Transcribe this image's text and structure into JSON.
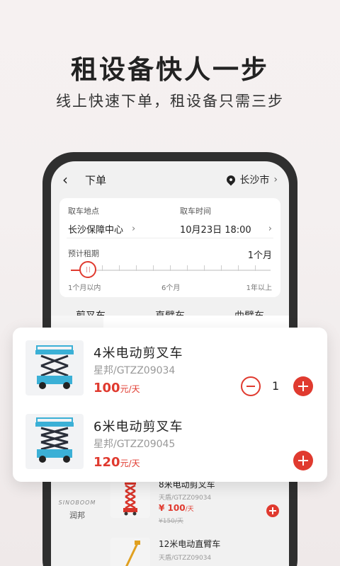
{
  "headline": "租设备快人一步",
  "subline": "线上快速下单，租设备只需三步",
  "nav": {
    "back": "‹",
    "title": "下单",
    "city": "长沙市"
  },
  "order": {
    "pickup_label": "取车地点",
    "pickup_value": "长沙保障中心",
    "time_label": "取车时间",
    "time_value": "10月23日  18:00",
    "period_label": "预计租期",
    "period_value": "1个月",
    "period_fraction": 0.05,
    "scale": [
      "1个月以内",
      "6个月",
      "1年以上"
    ]
  },
  "tabs": [
    "剪叉车",
    "直臂车",
    "曲臂车"
  ],
  "featured": [
    {
      "title": "4米电动剪叉车",
      "sub": "星邦/GTZZ09034",
      "price": "100",
      "unit": "元/天",
      "qty": "1"
    },
    {
      "title": "6米电动剪叉车",
      "sub": "星邦/GTZZ09045",
      "price": "120",
      "unit": "元/天"
    }
  ],
  "brand": {
    "logo": "SINOBOOM",
    "name": "润邦"
  },
  "list": [
    {
      "title": "8米电动剪叉车",
      "sub": "天盾/GTZZ09034",
      "price": "¥ 100",
      "unit": "/天",
      "old": "¥150/天"
    },
    {
      "title": "12米电动直臂车",
      "sub": "天盾/GTZZ09034"
    }
  ],
  "colors": {
    "accent": "#e03a2f",
    "machine": "#3bb0d6"
  }
}
